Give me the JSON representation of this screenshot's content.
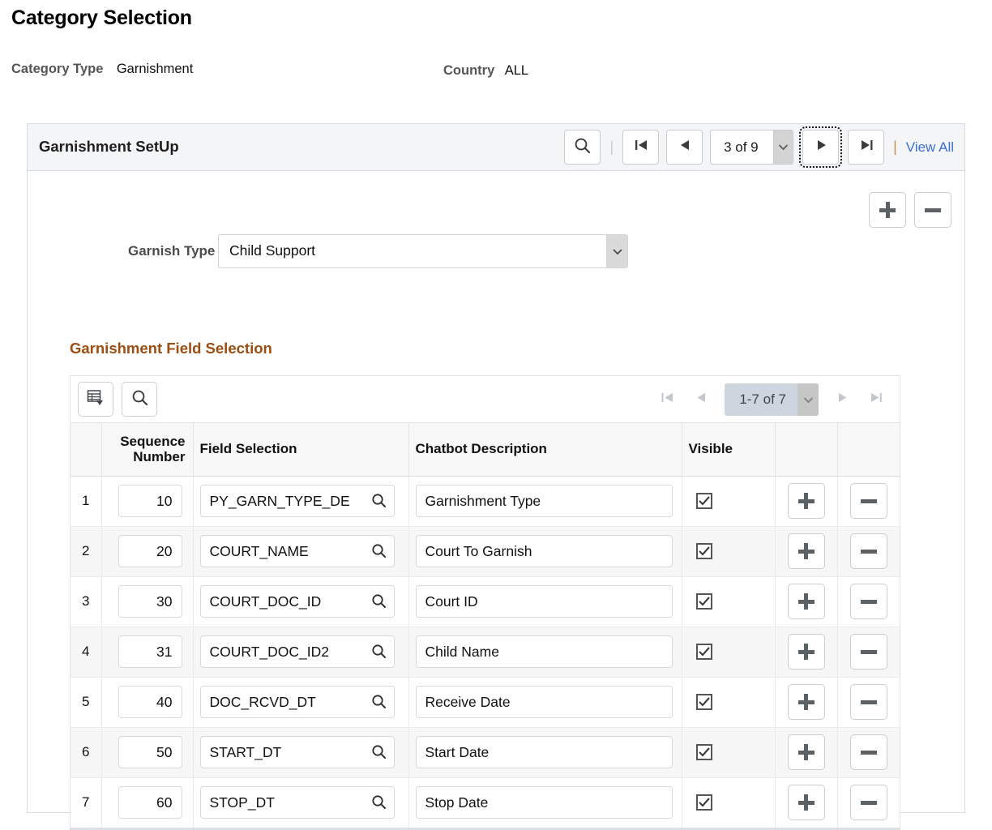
{
  "page": {
    "title": "Category Selection",
    "category_type_label": "Category Type",
    "category_type_value": "Garnishment",
    "country_label": "Country",
    "country_value": "ALL"
  },
  "panel": {
    "title": "Garnishment SetUp",
    "pager": {
      "search_icon": "search-icon",
      "first_icon": "first-page-icon",
      "prev_icon": "previous-page-icon",
      "position": "3 of 9",
      "next_icon": "next-page-icon",
      "last_icon": "last-page-icon",
      "view_all": "View All"
    },
    "row_controls": {
      "add": "add-row-icon",
      "delete": "delete-row-icon"
    },
    "garnish_type": {
      "label": "Garnish Type",
      "value": "Child Support",
      "options": [
        "Child Support"
      ]
    }
  },
  "grid": {
    "title": "Garnishment Field Selection",
    "toolbar": {
      "spreadsheet_icon": "download-to-spreadsheet-icon",
      "find_icon": "find-icon"
    },
    "pager": {
      "first_icon": "first-page-icon",
      "prev_icon": "previous-page-icon",
      "range": "1-7 of 7",
      "next_icon": "next-page-icon",
      "last_icon": "last-page-icon"
    },
    "headers": {
      "index": "",
      "sequence": "Sequence Number",
      "field": "Field Selection",
      "description": "Chatbot Description",
      "visible": "Visible",
      "add": "",
      "delete": ""
    },
    "rows": [
      {
        "index": "1",
        "sequence": "10",
        "field": "PY_GARN_TYPE_DE",
        "description": "Garnishment Type",
        "visible": true
      },
      {
        "index": "2",
        "sequence": "20",
        "field": "COURT_NAME",
        "description": "Court To Garnish",
        "visible": true
      },
      {
        "index": "3",
        "sequence": "30",
        "field": "COURT_DOC_ID",
        "description": "Court ID",
        "visible": true
      },
      {
        "index": "4",
        "sequence": "31",
        "field": "COURT_DOC_ID2",
        "description": "Child Name",
        "visible": true
      },
      {
        "index": "5",
        "sequence": "40",
        "field": "DOC_RCVD_DT",
        "description": "Receive Date",
        "visible": true
      },
      {
        "index": "6",
        "sequence": "50",
        "field": "START_DT",
        "description": "Start Date",
        "visible": true
      },
      {
        "index": "7",
        "sequence": "60",
        "field": "STOP_DT",
        "description": "Stop Date",
        "visible": true
      }
    ]
  },
  "colors": {
    "link": "#3b6fd4",
    "grid_title": "#9c4d12",
    "header_band": "#f4f5f6",
    "alt_row": "#f7f7f7"
  }
}
